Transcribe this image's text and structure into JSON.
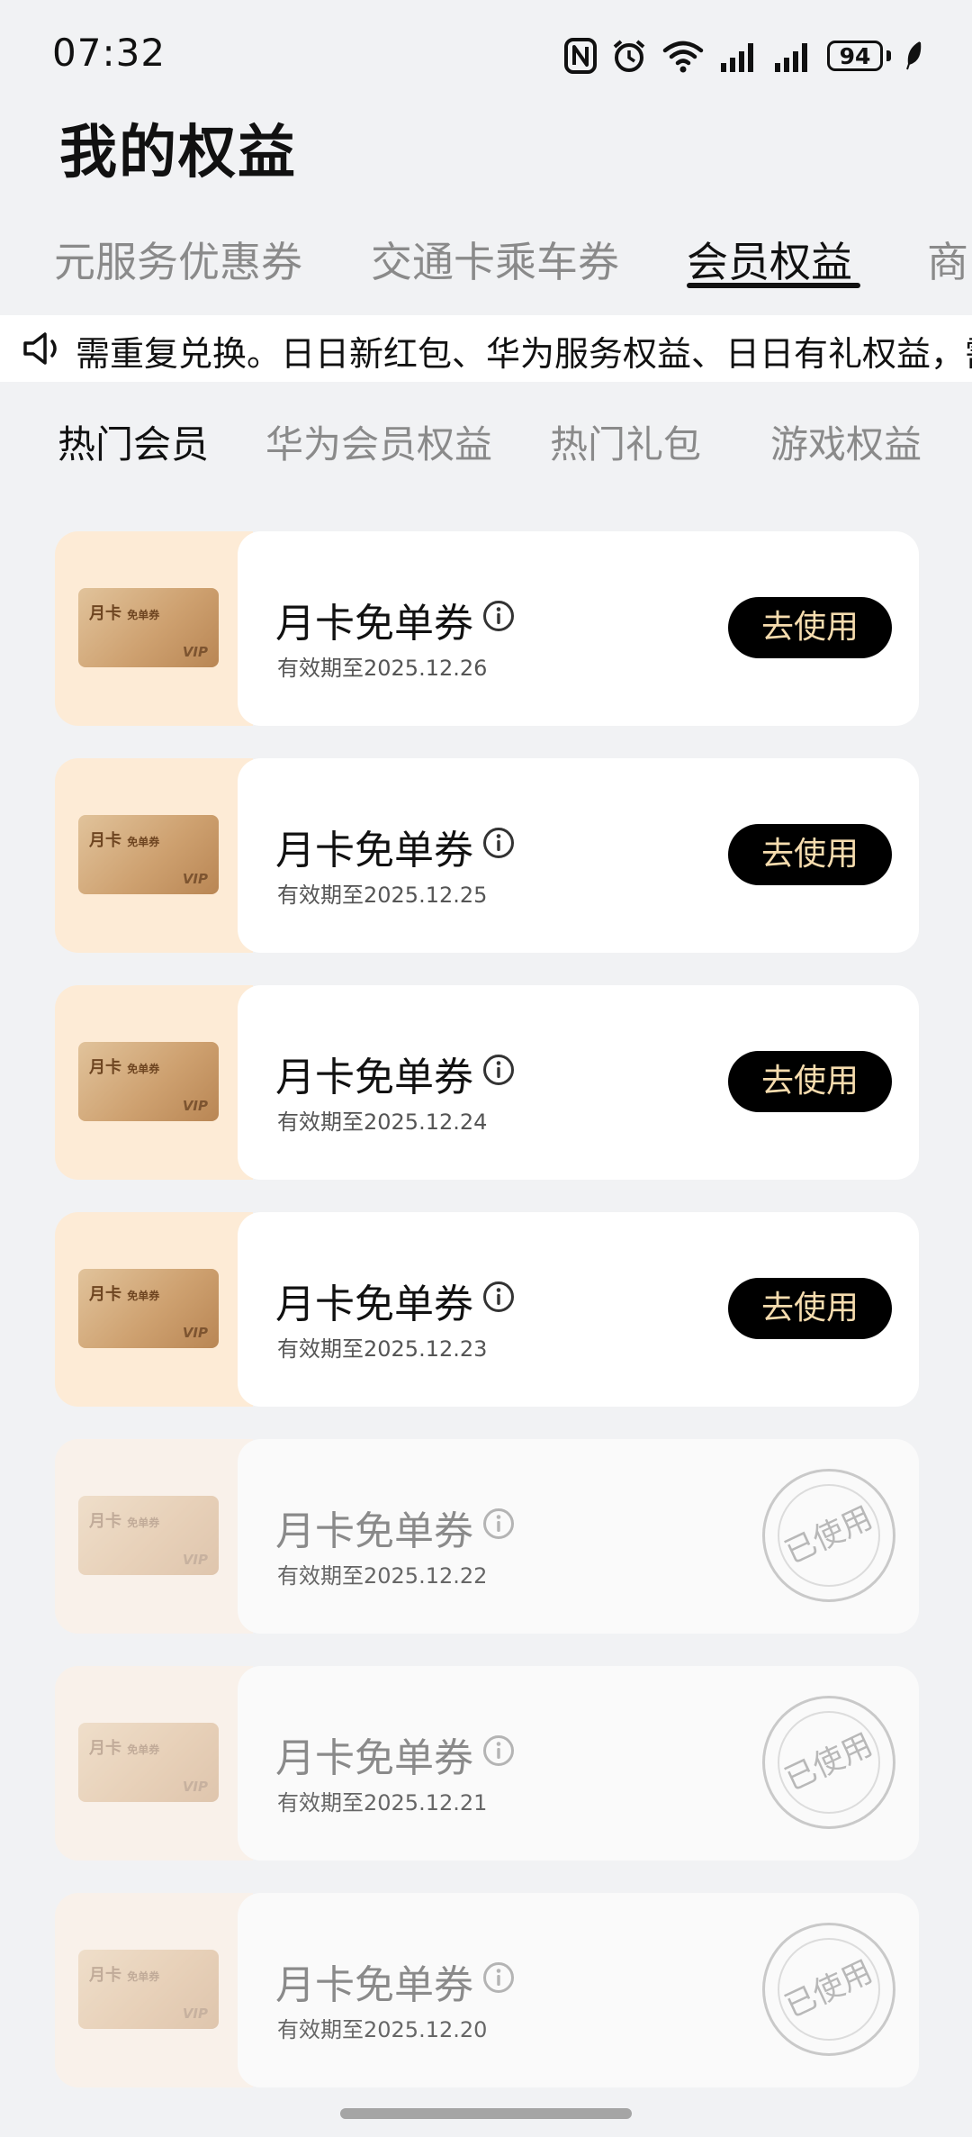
{
  "status_bar": {
    "time": "07:32",
    "battery": "94",
    "icons": [
      "nfc-icon",
      "alarm-icon",
      "wifi-icon",
      "signal-icon",
      "signal-icon",
      "leaf-icon"
    ]
  },
  "page_title": "我的权益",
  "top_tabs": [
    {
      "label": "元服务优惠券",
      "active": false
    },
    {
      "label": "交通卡乘车券",
      "active": false
    },
    {
      "label": "会员权益",
      "active": true
    },
    {
      "label": "商",
      "active": false
    }
  ],
  "notice": {
    "icon": "speaker-icon",
    "text": "需重复兑换。日日新红包、华为服务权益、日日有礼权益，需"
  },
  "sub_tabs": [
    {
      "label": "热门会员",
      "active": true
    },
    {
      "label": "华为会员权益",
      "active": false
    },
    {
      "label": "热门礼包",
      "active": false
    },
    {
      "label": "游戏权益",
      "active": false
    }
  ],
  "coupon_thumb": {
    "title": "月卡",
    "subtitle": "免单券",
    "mark": "VIP"
  },
  "coupons": [
    {
      "name": "月卡免单券",
      "expiry": "有效期至2025.12.26",
      "action": "去使用",
      "used": false
    },
    {
      "name": "月卡免单券",
      "expiry": "有效期至2025.12.25",
      "action": "去使用",
      "used": false
    },
    {
      "name": "月卡免单券",
      "expiry": "有效期至2025.12.24",
      "action": "去使用",
      "used": false
    },
    {
      "name": "月卡免单券",
      "expiry": "有效期至2025.12.23",
      "action": "去使用",
      "used": false
    },
    {
      "name": "月卡免单券",
      "expiry": "有效期至2025.12.22",
      "action": "已使用",
      "used": true
    },
    {
      "name": "月卡免单券",
      "expiry": "有效期至2025.12.21",
      "action": "已使用",
      "used": true
    },
    {
      "name": "月卡免单券",
      "expiry": "有效期至2025.12.20",
      "action": "已使用",
      "used": true
    }
  ],
  "colors": {
    "background": "#f1f2f4",
    "button_bg": "#000000",
    "button_text": "#f6dcae",
    "thumb_bg": "#fdebd6",
    "inactive_tab": "#8a8a8a"
  }
}
